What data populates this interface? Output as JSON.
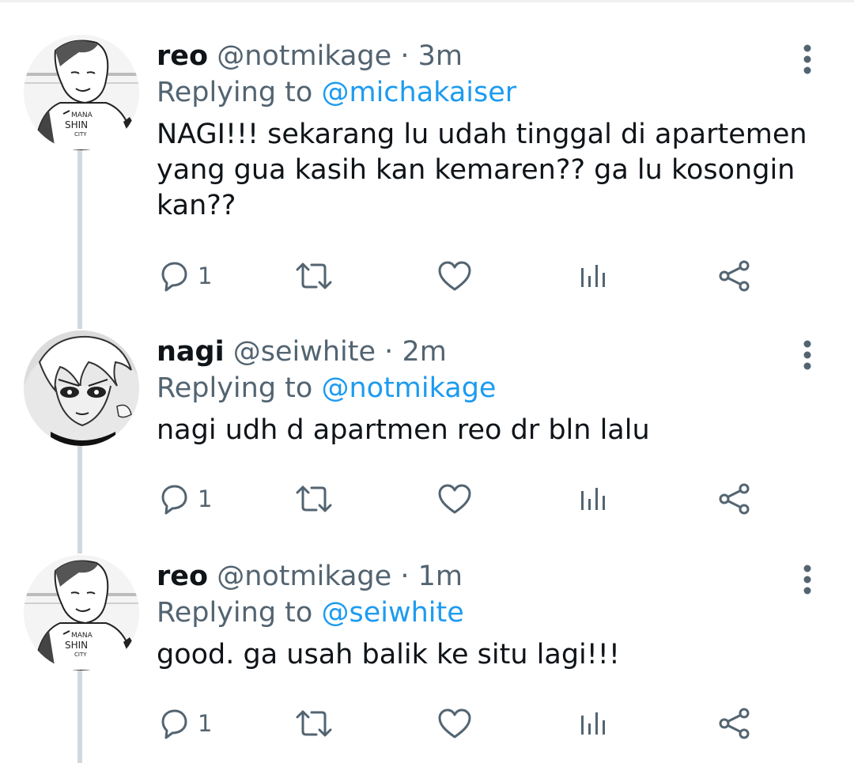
{
  "tweets": [
    {
      "name": "reo",
      "handle": "@notmikage",
      "separator": "·",
      "time": "3m",
      "replying_prefix": "Replying to",
      "replying_to": "@michakaiser",
      "text_lines": [
        "NAGI!!! sekarang lu udah tinggal di apartemen",
        "yang gua kasih kan kemaren?? ga lu kosongin",
        "kan??"
      ],
      "reply_count": "1",
      "avatar_icon": "avatar-reo",
      "jersey_text": [
        "MANA",
        "SHIN",
        "CITY"
      ]
    },
    {
      "name": "nagi",
      "handle": "@seiwhite",
      "separator": "·",
      "time": "2m",
      "replying_prefix": "Replying to",
      "replying_to": "@notmikage",
      "text_lines": [
        "nagi udh d apartmen reo dr bln lalu"
      ],
      "reply_count": "1",
      "avatar_icon": "avatar-nagi"
    },
    {
      "name": "reo",
      "handle": "@notmikage",
      "separator": "·",
      "time": "1m",
      "replying_prefix": "Replying to",
      "replying_to": "@seiwhite",
      "text_lines": [
        "good. ga usah balik ke situ lagi!!!"
      ],
      "reply_count": "1",
      "avatar_icon": "avatar-reo",
      "jersey_text": [
        "MANA",
        "SHIN",
        "CITY"
      ]
    }
  ],
  "icons": {
    "reply": "reply-icon",
    "retweet": "retweet-icon",
    "like": "heart-icon",
    "views": "views-icon",
    "share": "share-icon",
    "more": "more-vertical-icon"
  },
  "colors": {
    "text": "#0f1419",
    "secondary": "#536471",
    "link": "#1d9bf0",
    "thread_line": "#cfd9de"
  }
}
